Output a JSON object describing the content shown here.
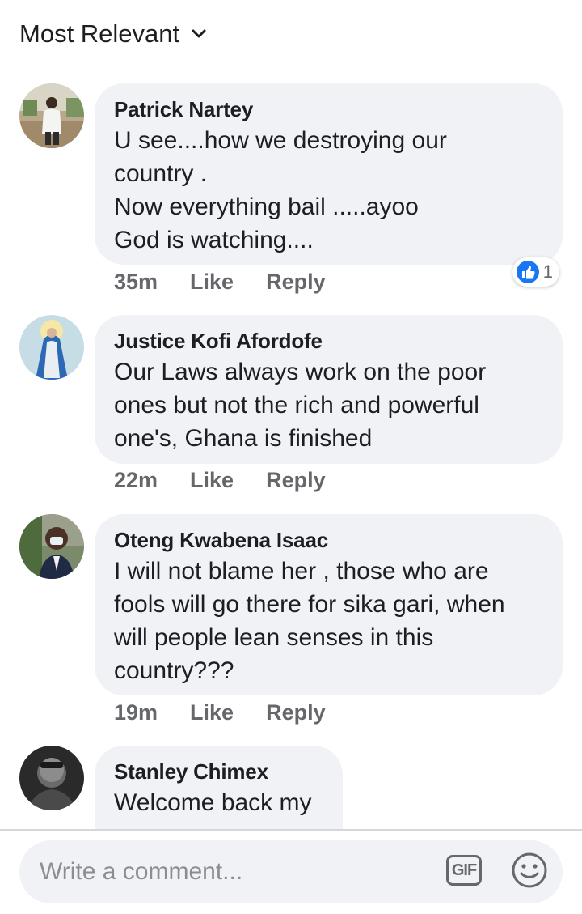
{
  "sort": {
    "label": "Most Relevant"
  },
  "comments": [
    {
      "author": "Patrick Nartey",
      "text": "U see....how we destroying our\ncountry .\nNow everything bail .....ayoo\nGod is watching....",
      "time": "35m",
      "like": "Like",
      "reply": "Reply",
      "reactions": {
        "count": "1",
        "type": "like"
      }
    },
    {
      "author": "Justice Kofi Afordofe",
      "text": "Our Laws always work on the poor\nones but not the rich and powerful\none's, Ghana is finished",
      "time": "22m",
      "like": "Like",
      "reply": "Reply"
    },
    {
      "author": "Oteng Kwabena Isaac",
      "text": "I will not blame her , those who are\nfools will go there for sika gari,  when\nwill people lean senses in this\ncountry???",
      "time": "19m",
      "like": "Like",
      "reply": "Reply"
    },
    {
      "author": "Stanley Chimex",
      "text": "Welcome back my"
    }
  ],
  "composer": {
    "placeholder": "Write a comment...",
    "gif_label": "GIF",
    "emoji_icon": "smiley-icon"
  },
  "colors": {
    "bubble": "#f0f2f5",
    "meta": "#65676b",
    "like_blue": "#1877f2"
  }
}
